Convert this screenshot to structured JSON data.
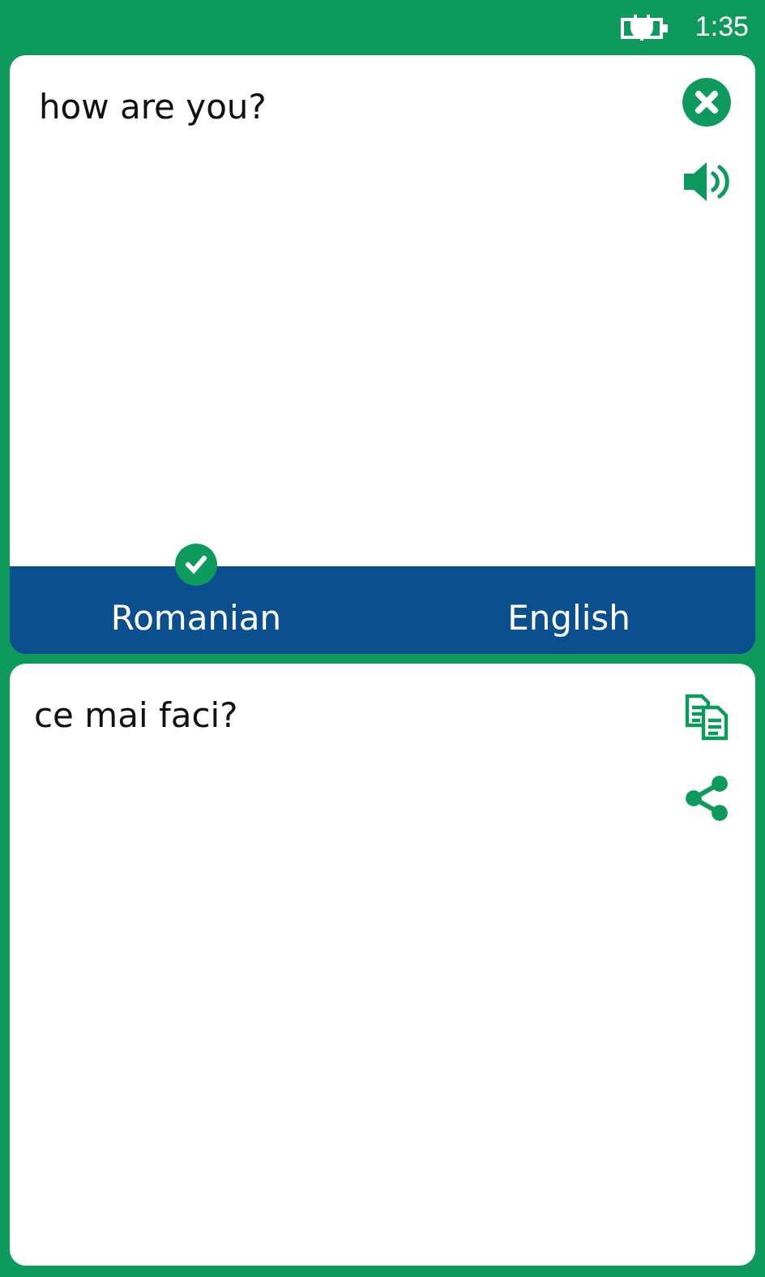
{
  "status_bar": {
    "time": "1:35"
  },
  "source": {
    "text": "how are you?"
  },
  "languages": [
    {
      "label": "Romanian",
      "selected": true
    },
    {
      "label": "English",
      "selected": false
    }
  ],
  "result": {
    "text": "ce mai faci?"
  }
}
